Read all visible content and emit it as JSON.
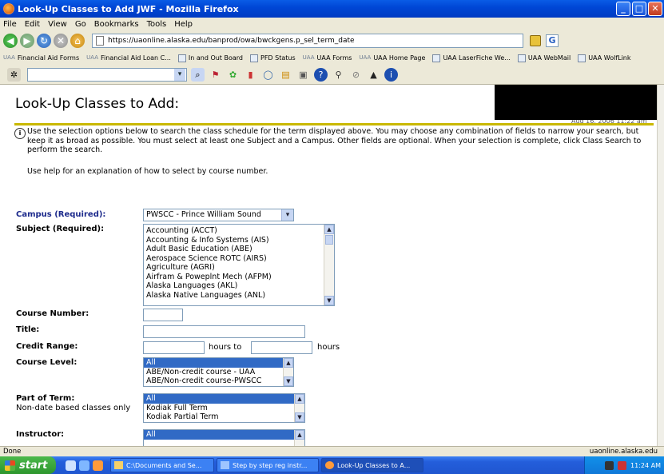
{
  "window": {
    "title": "Look-Up Classes to Add JWF - Mozilla Firefox"
  },
  "menu": [
    "File",
    "Edit",
    "View",
    "Go",
    "Bookmarks",
    "Tools",
    "Help"
  ],
  "nav": {
    "url": "https://uaonline.alaska.edu/banprod/owa/bwckgens.p_sel_term_date",
    "go_label": "G"
  },
  "bookmarks": [
    {
      "label": "Financial Aid Forms",
      "prefix": "UAA"
    },
    {
      "label": "Financial Aid Loan C...",
      "prefix": "UAA"
    },
    {
      "label": "In and Out Board",
      "prefix": ""
    },
    {
      "label": "PFD Status",
      "prefix": ""
    },
    {
      "label": "UAA Forms",
      "prefix": "UAA"
    },
    {
      "label": "UAA Home Page",
      "prefix": "UAA"
    },
    {
      "label": "UAA LaserFiche We...",
      "prefix": ""
    },
    {
      "label": "UAA WebMail",
      "prefix": ""
    },
    {
      "label": "UAA WolfLink",
      "prefix": ""
    }
  ],
  "page": {
    "title": "Look-Up Classes to Add:",
    "date_partial": "Aug 16, 2006 11:22 am",
    "info": "Use the selection options below to search the class schedule for the term displayed above. You may choose any combination of fields to narrow your search, but keep it as broad as possible. You must select at least one Subject and a Campus. Other fields are optional. When your selection is complete, click Class Search to perform the search.",
    "help": "Use help for an explanation of how to select by course number.",
    "campus_label": "Campus (Required):",
    "campus_value": "PWSCC - Prince William Sound",
    "subject_label": "Subject (Required):",
    "subjects": [
      "Accounting (ACCT)",
      "Accounting & Info Systems (AIS)",
      "Adult Basic Education (ABE)",
      "Aerospace Science ROTC (AIRS)",
      "Agriculture (AGRI)",
      "Airfram & Poweplnt Mech (AFPM)",
      "Alaska Languages (AKL)",
      "Alaska Native Languages (ANL)"
    ],
    "course_number_label": "Course Number:",
    "title_label": "Title:",
    "credit_range_label": "Credit Range:",
    "hours_to": "hours to",
    "hours": "hours",
    "course_level_label": "Course Level:",
    "course_levels": [
      "All",
      "ABE/Non-credit course - UAA",
      "ABE/Non-credit course-PWSCC"
    ],
    "part_of_term_label": "Part of Term:",
    "part_of_term_sub": "Non-date based classes only",
    "part_of_term_options": [
      "All",
      "Kodiak Full Term",
      "Kodiak Partial Term"
    ],
    "instructor_label": "Instructor:",
    "instructor_options": [
      "All"
    ]
  },
  "status": {
    "left": "Done",
    "right": "uaonline.alaska.edu"
  },
  "taskbar": {
    "start": "start",
    "tasks": [
      "C:\\Documents and Se...",
      "Step by step reg instr...",
      "Look-Up Classes to A..."
    ],
    "clock": "11:24 AM"
  },
  "colors": {
    "accent_rule": "#c9b800",
    "label_blue": "#1c2a8c",
    "selection": "#316ac5"
  }
}
